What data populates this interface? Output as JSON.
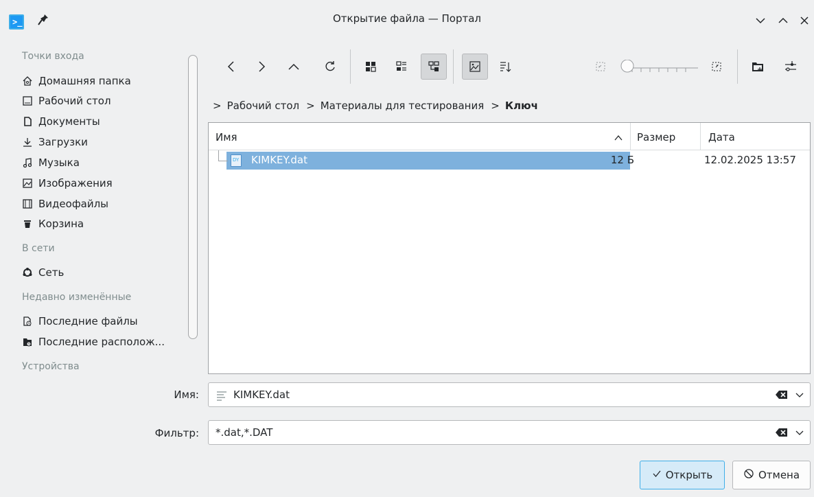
{
  "window": {
    "title": "Открытие файла — Портал"
  },
  "sidebar": {
    "sections": [
      {
        "heading": "Точки входа",
        "items": [
          {
            "label": "Домашняя папка",
            "icon": "home-icon"
          },
          {
            "label": "Рабочий стол",
            "icon": "desktop-icon"
          },
          {
            "label": "Документы",
            "icon": "documents-icon"
          },
          {
            "label": "Загрузки",
            "icon": "downloads-icon"
          },
          {
            "label": "Музыка",
            "icon": "music-icon"
          },
          {
            "label": "Изображения",
            "icon": "images-icon"
          },
          {
            "label": "Видеофайлы",
            "icon": "videos-icon"
          },
          {
            "label": "Корзина",
            "icon": "trash-icon"
          }
        ]
      },
      {
        "heading": "В сети",
        "items": [
          {
            "label": "Сеть",
            "icon": "network-icon"
          }
        ]
      },
      {
        "heading": "Недавно изменённые",
        "items": [
          {
            "label": "Последние файлы",
            "icon": "recent-files-icon"
          },
          {
            "label": "Последние располож...",
            "icon": "recent-locations-icon"
          }
        ]
      },
      {
        "heading": "Устройства",
        "items": []
      }
    ]
  },
  "breadcrumb": {
    "items": [
      "Рабочий стол",
      "Материалы для тестирования",
      "Ключ"
    ]
  },
  "fileview": {
    "columns": {
      "name": "Имя",
      "size": "Размер",
      "date": "Дата"
    },
    "rows": [
      {
        "name": "KIMKEY.dat",
        "size": "12 Б",
        "date": "12.02.2025 13:57",
        "icon_text": "DY",
        "selected": true
      }
    ]
  },
  "form": {
    "name_label": "Имя:",
    "name_value": "KIMKEY.dat",
    "filter_label": "Фильтр:",
    "filter_value": "*.dat,*.DAT"
  },
  "buttons": {
    "open": "Открыть",
    "cancel": "Отмена"
  },
  "colors": {
    "accent": "#3daee9",
    "selection": "#7eb1dd",
    "window_bg": "#eff0f1"
  }
}
